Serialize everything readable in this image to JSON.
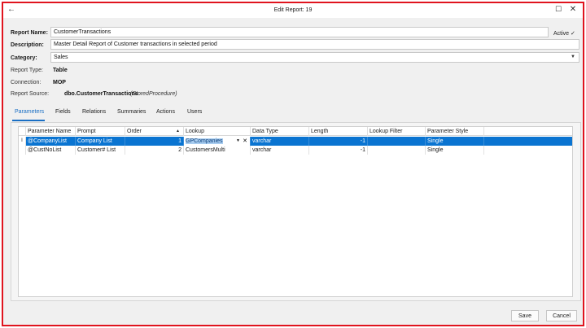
{
  "window": {
    "title": "Edit Report: 19",
    "back_icon": "back-arrow-icon",
    "maximize_icon": "maximize-icon",
    "close_icon": "close-icon"
  },
  "form": {
    "report_name_label": "Report Name:",
    "report_name_value": "CustomerTransactions",
    "active_label": "Active",
    "active_checked": true,
    "description_label": "Description:",
    "description_value": "Master Detail Report of Customer transactions in selected period",
    "category_label": "Category:",
    "category_value": "Sales",
    "report_type_label": "Report Type:",
    "report_type_value": "Table",
    "connection_label": "Connection:",
    "connection_value": "MOP",
    "report_source_label": "Report Source:",
    "report_source_value": "dbo.CustomerTransactions",
    "report_source_kind": "(StoredProcedure)"
  },
  "tabs": [
    "Parameters",
    "Fields",
    "Relations",
    "Summaries",
    "Actions",
    "Users"
  ],
  "selected_tab": "Parameters",
  "grid": {
    "columns": [
      "Parameter Name",
      "Prompt",
      "Order",
      "Lookup",
      "Data Type",
      "Length",
      "Lookup Filter",
      "Parameter Style"
    ],
    "sort_indicator": "▲",
    "rows": [
      {
        "marker": "I",
        "name": "@CompanyList",
        "prompt": "Company List",
        "order": "1",
        "lookup": "GPCompanies",
        "data_type": "varchar",
        "length": "-1",
        "lookup_filter": "",
        "style": "Single",
        "selected": true
      },
      {
        "marker": "",
        "name": "@CustNoList",
        "prompt": "Customer# List",
        "order": "2",
        "lookup": "CustomersMulti",
        "data_type": "varchar",
        "length": "-1",
        "lookup_filter": "",
        "style": "Single",
        "selected": false
      }
    ]
  },
  "buttons": {
    "save": "Save",
    "cancel": "Cancel"
  },
  "colors": {
    "selection": "#0a74d1",
    "accent_tab": "#1a6fc4",
    "window_border": "#e0141e"
  }
}
